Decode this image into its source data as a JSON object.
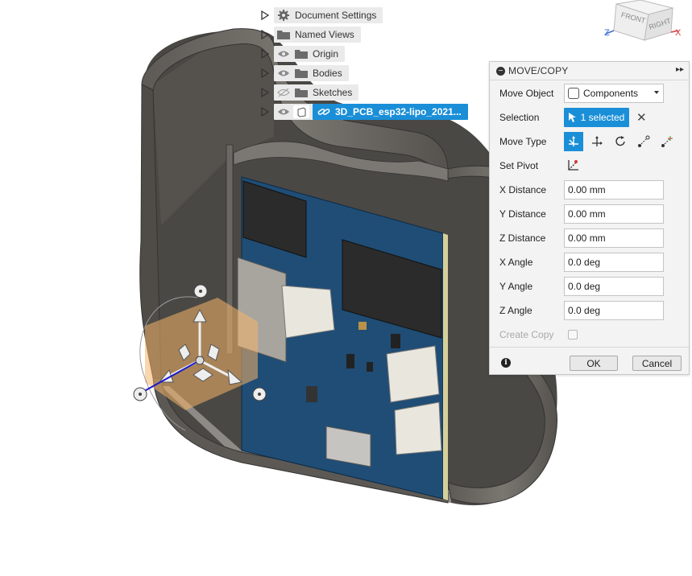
{
  "browser_tree": {
    "items": [
      {
        "label": "Document Settings",
        "icon": "gear-icon"
      },
      {
        "label": "Named Views",
        "icon": "folder-icon"
      },
      {
        "label": "Origin",
        "icon": "folder-icon",
        "visible": true
      },
      {
        "label": "Bodies",
        "icon": "folder-icon",
        "visible": true
      },
      {
        "label": "Sketches",
        "icon": "folder-icon",
        "visible": false
      },
      {
        "label": "3D_PCB_esp32-lipo_2021...",
        "icon": "link-icon",
        "visible": true,
        "selected": true
      }
    ]
  },
  "viewcube": {
    "front": "FRONT",
    "right": "RIGHT",
    "axis_z": "Z",
    "axis_x": "X"
  },
  "panel": {
    "title": "MOVE/COPY",
    "expand": "▸▸",
    "move_object": {
      "label": "Move Object",
      "value": "Components"
    },
    "selection": {
      "label": "Selection",
      "value": "1 selected",
      "clear": "✕"
    },
    "move_type": {
      "label": "Move Type",
      "options": [
        "free-move-icon",
        "translate-icon",
        "rotate-icon",
        "point-to-point-icon",
        "point-to-position-icon"
      ],
      "active": 0
    },
    "set_pivot": {
      "label": "Set Pivot"
    },
    "x_distance": {
      "label": "X Distance",
      "value": "0.00 mm"
    },
    "y_distance": {
      "label": "Y Distance",
      "value": "0.00 mm"
    },
    "z_distance": {
      "label": "Z Distance",
      "value": "0.00 mm"
    },
    "x_angle": {
      "label": "X Angle",
      "value": "0.0 deg"
    },
    "y_angle": {
      "label": "Y Angle",
      "value": "0.0 deg"
    },
    "z_angle": {
      "label": "Z Angle",
      "value": "0.0 deg"
    },
    "create_copy": {
      "label": "Create Copy",
      "checked": false
    },
    "ok": "OK",
    "cancel": "Cancel",
    "info": "i"
  },
  "colors": {
    "accent": "#1a8fd8",
    "case_gray": "#6e6b66",
    "pcb_blue": "#1f4d75",
    "pivot_orange": "#f5b56a"
  }
}
